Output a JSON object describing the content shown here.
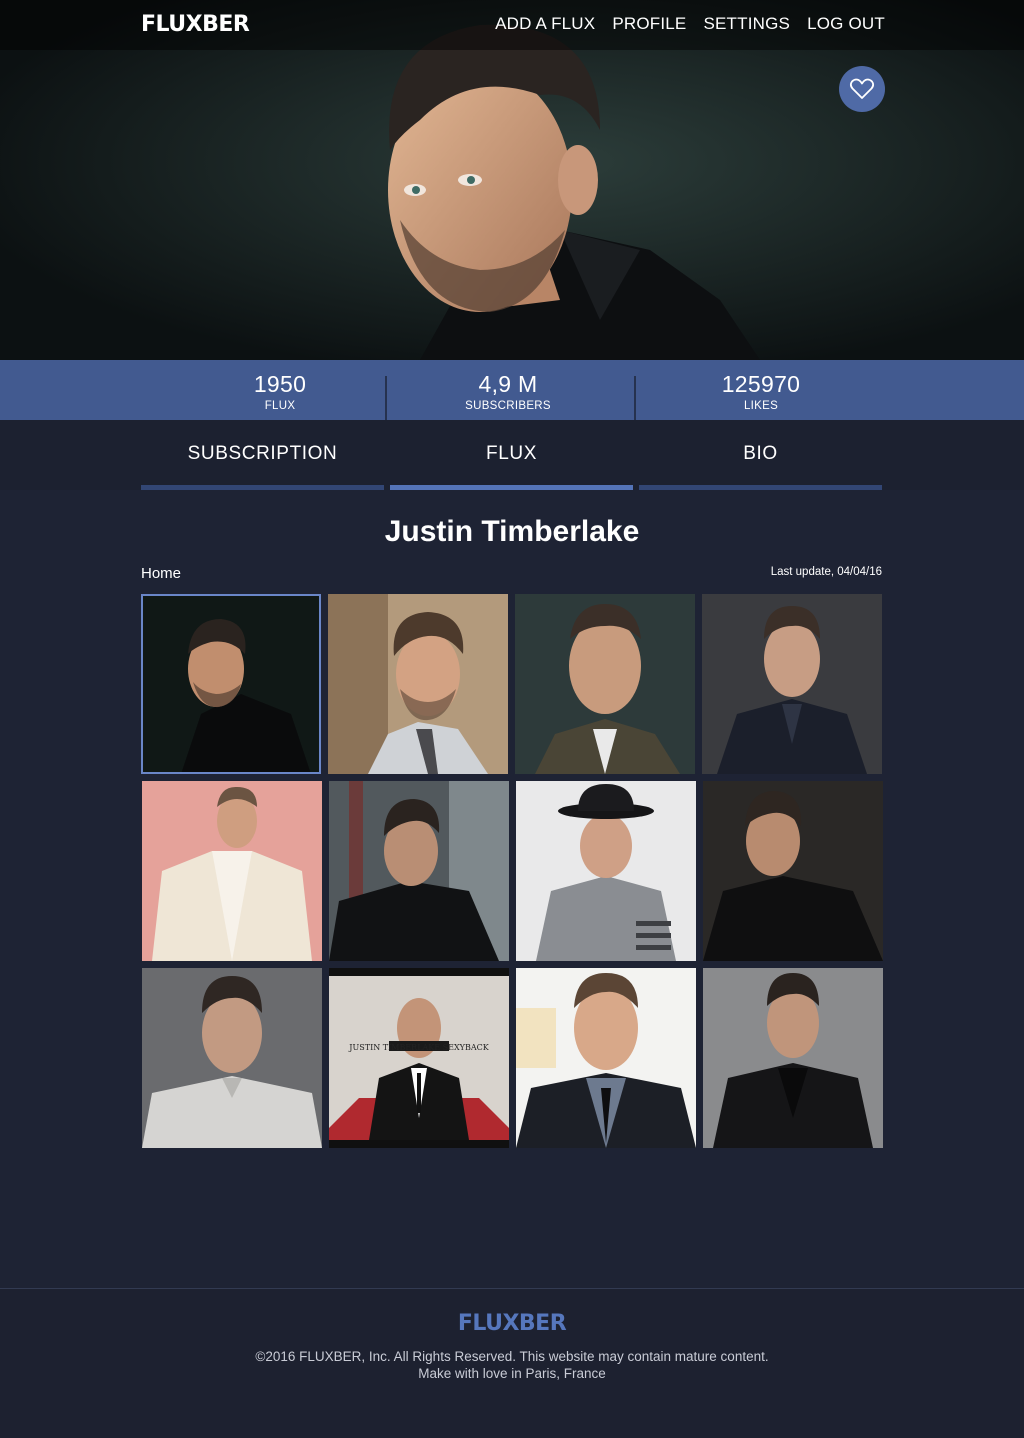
{
  "header": {
    "logo": "FLUXBER",
    "nav": [
      "ADD A FLUX",
      "PROFILE",
      "SETTINGS",
      "LOG OUT"
    ],
    "favorite_icon": "heart-outline-icon"
  },
  "stats": [
    {
      "value": "1950",
      "label": "FLUX"
    },
    {
      "value": "4,9 M",
      "label": "SUBSCRIBERS"
    },
    {
      "value": "125970",
      "label": "LIKES"
    }
  ],
  "tabs": [
    {
      "label": "SUBSCRIPTION",
      "active": false
    },
    {
      "label": "FLUX",
      "active": true
    },
    {
      "label": "BIO",
      "active": false
    }
  ],
  "main": {
    "title": "Justin Timberlake",
    "breadcrumb": "Home",
    "last_update": "Last update, 04/04/16"
  },
  "album_cover": {
    "text": "JUSTIN TIMBERLAKE SEXYBACK"
  },
  "footer": {
    "logo": "FLUXBER",
    "copyright": "©2016 FLUXBER, Inc. All Rights Reserved. This website may contain mature content.",
    "made_with": "Make with love in Paris, France"
  },
  "colors": {
    "accent": "#425a90",
    "tab_active": "#5474b8",
    "tab_inactive": "#324674",
    "background": "#1e2334"
  }
}
